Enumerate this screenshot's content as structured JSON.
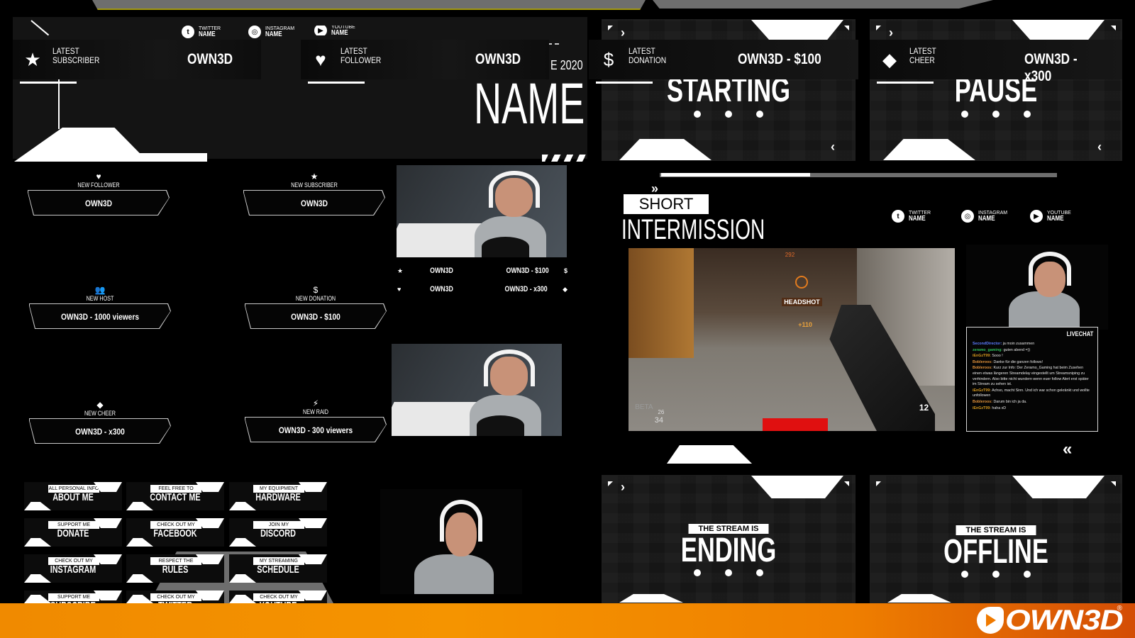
{
  "brand": {
    "logo_text": "OWN3D",
    "registered": "®",
    "footer_color": "#f59400"
  },
  "info_bars": [
    {
      "icon": "star-icon",
      "glyph": "★",
      "label_line1": "LATEST",
      "label_line2": "SUBSCRIBER",
      "value": "OWN3D"
    },
    {
      "icon": "heart-icon",
      "glyph": "♥",
      "label_line1": "LATEST",
      "label_line2": "FOLLOWER",
      "value": "OWN3D"
    },
    {
      "icon": "dollar-icon",
      "glyph": "$",
      "label_line1": "LATEST",
      "label_line2": "DONATION",
      "value": "OWN3D - $100"
    },
    {
      "icon": "diamond-icon",
      "glyph": "◆",
      "label_line1": "LATEST",
      "label_line2": "CHEER",
      "value": "OWN3D - x300"
    }
  ],
  "top_socials": [
    {
      "icon": "twitter-icon",
      "platform": "TWITTER",
      "name": "NAME"
    },
    {
      "icon": "instagram-icon",
      "platform": "INSTAGRAM",
      "name": "NAME"
    },
    {
      "icon": "youtube-icon",
      "platform": "YOUTUBE",
      "name": "NAME"
    }
  ],
  "name_block": {
    "year": "E 2020",
    "title": "NAME"
  },
  "scenes": {
    "starting": {
      "title": "STARTING"
    },
    "pause": {
      "title": "PAUSE"
    },
    "ending": {
      "tag": "THE STREAM IS",
      "title": "ENDING"
    },
    "offline": {
      "tag": "THE STREAM IS",
      "title": "OFFLINE"
    }
  },
  "intermission": {
    "tag": "SHORT",
    "title": "INTERMISSION",
    "socials": [
      {
        "icon": "twitter-icon",
        "platform": "TWITTER",
        "name": "NAME"
      },
      {
        "icon": "instagram-icon",
        "platform": "INSTAGRAM",
        "name": "NAME"
      },
      {
        "icon": "youtube-icon",
        "platform": "YOUTUBE",
        "name": "NAME"
      }
    ],
    "game_hud": {
      "headshot": "HEADSHOT",
      "points": "+110",
      "compass": "292",
      "ammo": "12",
      "health_a": "26",
      "health_b": "34",
      "beta": "BETA"
    },
    "chat": {
      "title": "LIVECHAT",
      "messages": [
        {
          "user": "SecondDirector:",
          "color": "#5b7cff",
          "text": "ja moin zusammen"
        },
        {
          "user": "zeramo_gaming:",
          "color": "#2fbf5a",
          "text": "guten abend =))"
        },
        {
          "user": "iEnGzT99:",
          "color": "#d89a1e",
          "text": "Sooo !"
        },
        {
          "user": "Bobleroos:",
          "color": "#e0913a",
          "text": "Danke für die ganzen follows!"
        },
        {
          "user": "Bobleroos:",
          "color": "#e0913a",
          "text": "Kurz zur Info: Der Zeramo_Gaming hat beim Zusehen einen etwas längeren Streamdelay eingestellt um Streamsniping zu verhindern. Also bitte nicht wundern wenn euer follow Alert erst später im Stream zu sehen ist."
        },
        {
          "user": "iEnGzT99:",
          "color": "#d89a1e",
          "text": "Achso, macht Sinn. Und ich war schon gekränkt und wollte unfollowen"
        },
        {
          "user": "Bobleroos:",
          "color": "#e0913a",
          "text": "Darum bin ich ja da."
        },
        {
          "user": "iEnGzT99:",
          "color": "#d89a1e",
          "text": "haha xD"
        }
      ]
    }
  },
  "alerts": [
    {
      "icon": "heart-icon",
      "glyph": "♥",
      "label": "NEW FOLLOWER",
      "value": "OWN3D"
    },
    {
      "icon": "star-icon",
      "glyph": "★",
      "label": "NEW SUBSCRIBER",
      "value": "OWN3D"
    },
    {
      "icon": "group-icon",
      "glyph": "👥",
      "label": "NEW HOST",
      "value": "OWN3D - 1000 viewers"
    },
    {
      "icon": "dollar-icon",
      "glyph": "$",
      "label": "NEW DONATION",
      "value": "OWN3D - $100"
    },
    {
      "icon": "diamond-icon",
      "glyph": "◆",
      "label": "NEW CHEER",
      "value": "OWN3D - x300"
    },
    {
      "icon": "bolt-icon",
      "glyph": "⚡",
      "label": "NEW RAID",
      "value": "OWN3D - 300 viewers"
    }
  ],
  "webcam_stats": [
    {
      "left_icon": "star-icon",
      "left_glyph": "★",
      "left_value": "OWN3D",
      "right_value": "OWN3D - $100",
      "right_icon": "dollar-icon",
      "right_glyph": "$"
    },
    {
      "left_icon": "heart-icon",
      "left_glyph": "♥",
      "left_value": "OWN3D",
      "right_value": "OWN3D - x300",
      "right_icon": "diamond-icon",
      "right_glyph": "◆"
    }
  ],
  "panels": [
    {
      "sub": "ALL PERSONAL INFO",
      "title": "ABOUT ME"
    },
    {
      "sub": "FEEL FREE TO",
      "title": "CONTACT ME"
    },
    {
      "sub": "MY EQUIPMENT",
      "title": "HARDWARE"
    },
    {
      "sub": "SUPPORT ME",
      "title": "DONATE"
    },
    {
      "sub": "CHECK OUT MY",
      "title": "FACEBOOK"
    },
    {
      "sub": "JOIN MY",
      "title": "DISCORD"
    },
    {
      "sub": "CHECK OUT MY",
      "title": "INSTAGRAM"
    },
    {
      "sub": "RESPECT THE",
      "title": "RULES"
    },
    {
      "sub": "MY STREAMING",
      "title": "SCHEDULE"
    },
    {
      "sub": "SUPPORT ME",
      "title": "SUBSCRIBE"
    },
    {
      "sub": "CHECK OUT MY",
      "title": "TWITTER"
    },
    {
      "sub": "CHECK OUT MY",
      "title": "YOUTUBE"
    }
  ]
}
